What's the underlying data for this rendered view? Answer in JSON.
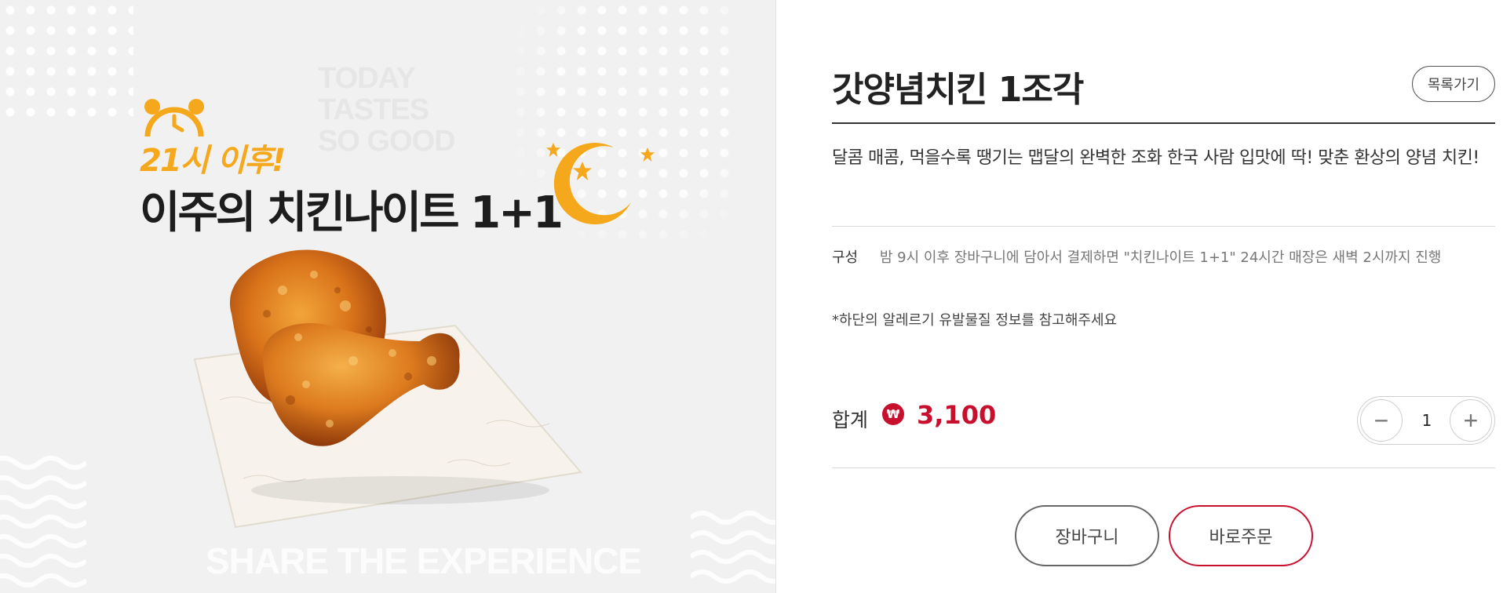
{
  "promo": {
    "badge": "21시 이후!",
    "headline": "이주의 치킨나이트 1+1",
    "ghost_today": [
      "TODAY",
      "TASTES",
      "SO GOOD"
    ],
    "ghost_share": "SHARE THE EXPERIENCE",
    "colors": {
      "accent": "#f6a81c",
      "background": "#f1f1f1"
    }
  },
  "product": {
    "title": "갓양념치킨 1조각",
    "list_button": "목록가기",
    "description": "달콤 매콤, 먹을수록 땡기는 맵달의 완벽한 조화 한국 사람 입맛에 딱! 맞춘 환상의 양념 치킨!",
    "composition_label": "구성",
    "composition_text": "밤 9시 이후 장바구니에 담아서 결제하면 \"치킨나이트 1+1\" 24시간 매장은 새벽 2시까지 진행",
    "allergy_note": "*하단의 알레르기 유발물질 정보를 참고해주세요",
    "total_label": "합계",
    "currency_symbol": "₩",
    "price": "3,100",
    "quantity": "1",
    "minus_symbol": "−",
    "plus_symbol": "+",
    "cart_button": "장바구니",
    "order_button": "바로주문",
    "colors": {
      "price": "#c8102e",
      "order_border": "#c8102e"
    }
  }
}
